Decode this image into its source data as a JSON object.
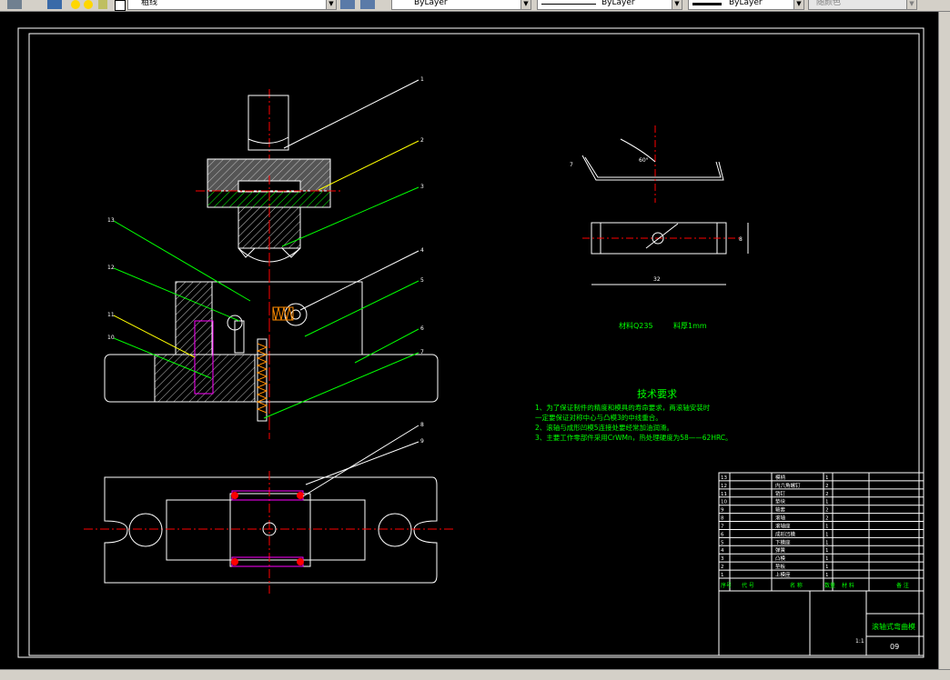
{
  "toolbar": {
    "layer_name": "粗线",
    "linetype_color": "ByLayer",
    "linetype": "ByLayer",
    "lineweight": "ByLayer",
    "plot_style": "随颜色"
  },
  "drawing": {
    "material_note": "材料Q235",
    "thickness_note": "料厚1mm",
    "angle_dim": "60°",
    "height_dim": "7",
    "width_dim": "8",
    "length_dim": "32",
    "tech_title": "技术要求",
    "tech_lines": [
      "1、为了保证制件的精度和模具的寿命要求，两滚轴安装时",
      "一定要保证对称中心与凸模3的中线重合。",
      "2、滚轴与成形凹模5连接处要经常加油润滑。",
      "3、主要工作零部件采用CrWMn，热处理硬度为58——62HRC。"
    ],
    "part_callouts": [
      "1",
      "2",
      "3",
      "4",
      "5",
      "6",
      "7",
      "8",
      "9",
      "10",
      "11",
      "12",
      "13"
    ],
    "bom_header": [
      "序号",
      "代 号",
      "名 称",
      "数量",
      "材 料",
      "备 注"
    ],
    "bom_rows": [
      {
        "no": "13",
        "name": "模柄",
        "qty": "1"
      },
      {
        "no": "12",
        "name": "内六角螺钉",
        "qty": "2"
      },
      {
        "no": "11",
        "name": "销钉",
        "qty": "2"
      },
      {
        "no": "10",
        "name": "垫块",
        "qty": "1"
      },
      {
        "no": "9",
        "name": "轴套",
        "qty": "2"
      },
      {
        "no": "8",
        "name": "滚轴",
        "qty": "2"
      },
      {
        "no": "7",
        "name": "滚轴座",
        "qty": "1"
      },
      {
        "no": "6",
        "name": "成形凹模",
        "qty": "1"
      },
      {
        "no": "5",
        "name": "下模座",
        "qty": "1"
      },
      {
        "no": "4",
        "name": "弹簧",
        "qty": "1"
      },
      {
        "no": "3",
        "name": "凸模",
        "qty": "1"
      },
      {
        "no": "2",
        "name": "垫板",
        "qty": "1"
      },
      {
        "no": "1",
        "name": "上模座",
        "qty": "1"
      }
    ],
    "title_block_name": "滚轴式弯曲模",
    "title_block_code": "09",
    "title_block_scale": "1:1"
  },
  "colors": {
    "background": "#000000",
    "outline": "#ffffff",
    "leader_line": "#ffff00",
    "text_green": "#00ff00",
    "center_line": "#ff0000",
    "hatch": "#c0c0c0"
  }
}
